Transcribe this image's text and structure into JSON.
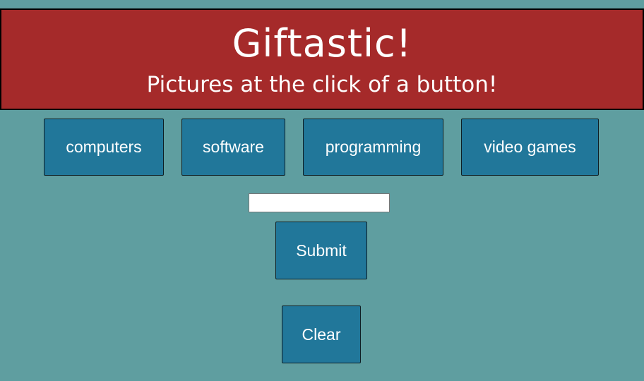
{
  "header": {
    "title": "Giftastic!",
    "subtitle": "Pictures at the click of a button!"
  },
  "topics": [
    {
      "label": "computers"
    },
    {
      "label": "software"
    },
    {
      "label": "programming"
    },
    {
      "label": "video games"
    }
  ],
  "search": {
    "value": "",
    "placeholder": ""
  },
  "actions": {
    "submit_label": "Submit",
    "clear_label": "Clear"
  },
  "colors": {
    "background": "#5f9ea0",
    "header": "#a52a2a",
    "button": "#21779a",
    "text": "#ffffff"
  }
}
